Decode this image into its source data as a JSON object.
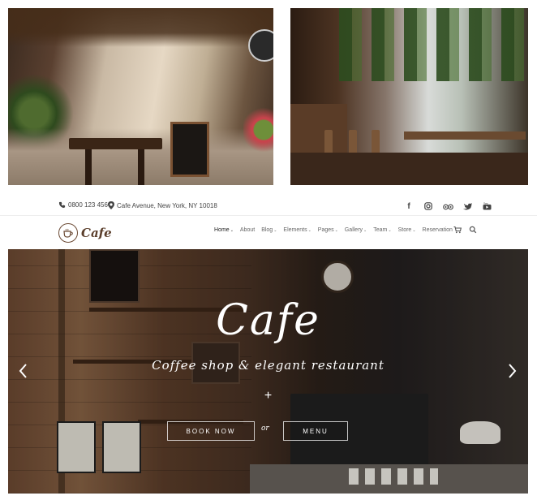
{
  "topbar": {
    "phone": "0800 123 456",
    "address": "Cafe Avenue, New York, NY 10018",
    "social_icons": [
      "facebook-icon",
      "instagram-icon",
      "tripadvisor-icon",
      "twitter-icon",
      "youtube-icon"
    ]
  },
  "nav": {
    "logo_text": "Cafe",
    "items": [
      {
        "label": "Home",
        "dropdown": true,
        "active": true
      },
      {
        "label": "About",
        "dropdown": false
      },
      {
        "label": "Blog",
        "dropdown": true
      },
      {
        "label": "Elements",
        "dropdown": true
      },
      {
        "label": "Pages",
        "dropdown": true
      },
      {
        "label": "Gallery",
        "dropdown": true
      },
      {
        "label": "Team",
        "dropdown": true
      },
      {
        "label": "Store",
        "dropdown": true
      },
      {
        "label": "Reservation",
        "dropdown": false
      }
    ],
    "caret": "⌄",
    "cart_icon": "cart-icon",
    "search_icon": "search-icon"
  },
  "hero": {
    "title": "Cafe",
    "subtitle": "Coffee shop & elegant restaurant",
    "plus": "+",
    "book_button": "BOOK NOW",
    "or_text": "or",
    "menu_button": "MENU",
    "prev_icon": "chevron-left-icon",
    "next_icon": "chevron-right-icon"
  },
  "colors": {
    "brand": "#5b3e2b",
    "text": "#444444",
    "menu_text": "#666666",
    "hero_text": "#ffffff"
  }
}
